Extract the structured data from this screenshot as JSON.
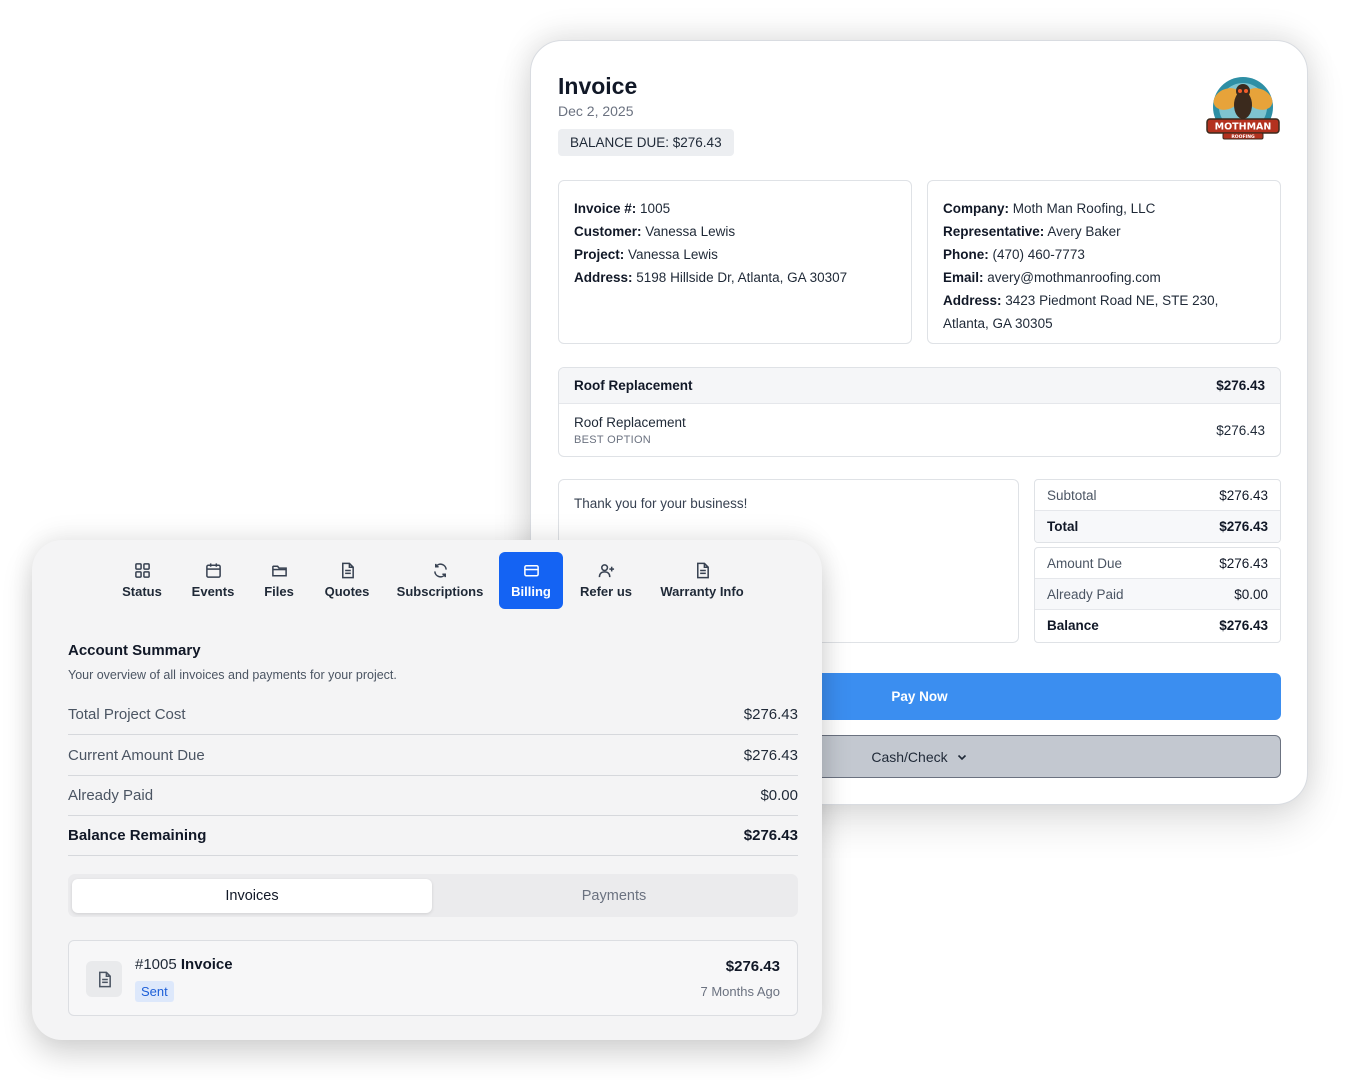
{
  "invoice": {
    "title": "Invoice",
    "date": "Dec 2, 2025",
    "balance_due": "BALANCE DUE: $276.43",
    "logo": {
      "icon": "mothman-roofing-logo",
      "text": "MOTHMAN",
      "subtext": "ROOFING",
      "colors": {
        "ring": "#2e8fa5",
        "banner": "#b3321f",
        "wings": "#e7a33a"
      }
    },
    "customer_info": [
      {
        "label": "Invoice #:",
        "value": "1005"
      },
      {
        "label": "Customer:",
        "value": "Vanessa Lewis"
      },
      {
        "label": "Project:",
        "value": "Vanessa Lewis"
      },
      {
        "label": "Address:",
        "value": "5198 Hillside Dr, Atlanta, GA 30307"
      }
    ],
    "company_info": [
      {
        "label": "Company:",
        "value": "Moth Man Roofing, LLC"
      },
      {
        "label": "Representative:",
        "value": "Avery Baker"
      },
      {
        "label": "Phone:",
        "value": "(470) 460-7773"
      },
      {
        "label": "Email:",
        "value": "avery@mothmanroofing.com"
      },
      {
        "label": "Address:",
        "value": "3423 Piedmont Road NE, STE 230, Atlanta, GA 30305"
      }
    ],
    "items_header": {
      "label": "Roof Replacement",
      "amount": "$276.43"
    },
    "items": [
      {
        "name": "Roof Replacement",
        "option": "BEST OPTION",
        "amount": "$276.43"
      }
    ],
    "notes": "Thank you for your business!",
    "totals": [
      {
        "label": "Subtotal",
        "value": "$276.43"
      },
      {
        "label": "Total",
        "value": "$276.43"
      }
    ],
    "balance": [
      {
        "label": "Amount Due",
        "value": "$276.43"
      },
      {
        "label": "Already Paid",
        "value": "$0.00"
      },
      {
        "label": "Balance",
        "value": "$276.43"
      }
    ],
    "pay_now_label": "Pay Now",
    "payment_method_label": "Cash/Check",
    "accent_color": "#3b8ef0"
  },
  "account": {
    "tabs": [
      {
        "label": "Status",
        "icon": "grid-icon"
      },
      {
        "label": "Events",
        "icon": "calendar-icon"
      },
      {
        "label": "Files",
        "icon": "folder-icon"
      },
      {
        "label": "Quotes",
        "icon": "document-icon"
      },
      {
        "label": "Subscriptions",
        "icon": "refresh-icon"
      },
      {
        "label": "Billing",
        "icon": "credit-card-icon",
        "active": true
      },
      {
        "label": "Refer us",
        "icon": "user-plus-icon"
      },
      {
        "label": "Warranty Info",
        "icon": "document-icon"
      }
    ],
    "active_tab_color": "#1463f3",
    "title": "Account Summary",
    "subtitle": "Your overview of all invoices and payments for your project.",
    "summary": [
      {
        "label": "Total Project Cost",
        "value": "$276.43"
      },
      {
        "label": "Current Amount Due",
        "value": "$276.43"
      },
      {
        "label": "Already Paid",
        "value": "$0.00"
      },
      {
        "label": "Balance Remaining",
        "value": "$276.43"
      }
    ],
    "segments": [
      {
        "label": "Invoices",
        "active": true
      },
      {
        "label": "Payments",
        "active": false
      }
    ],
    "invoice_list": [
      {
        "number": "#1005",
        "name": "Invoice",
        "status": "Sent",
        "amount": "$276.43",
        "age": "7 Months Ago",
        "icon": "document-icon"
      }
    ]
  }
}
